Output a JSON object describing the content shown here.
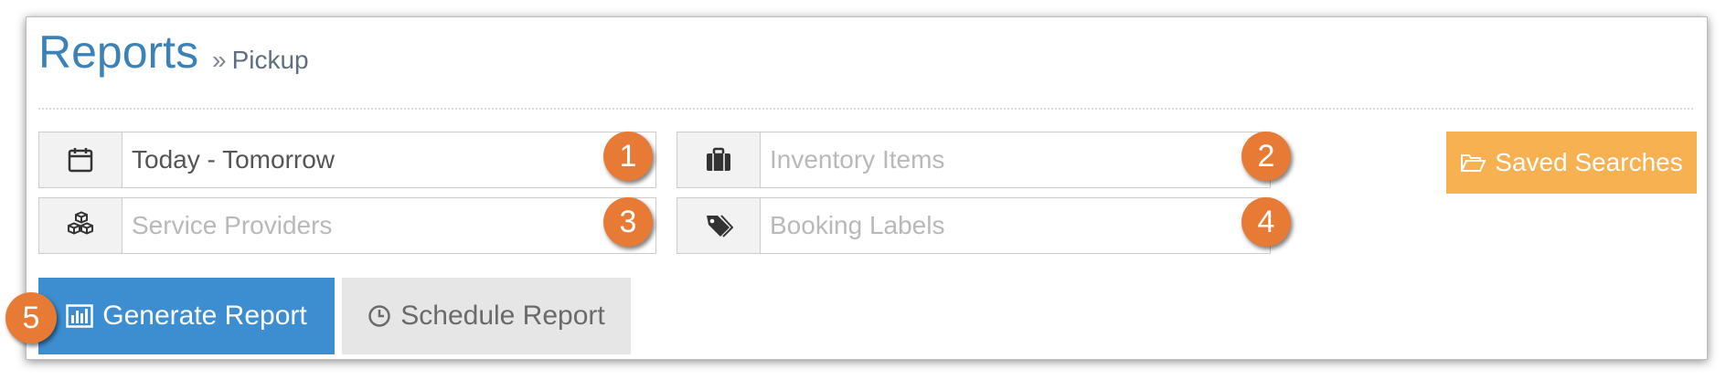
{
  "header": {
    "title": "Reports",
    "breadcrumb_separator": "»",
    "breadcrumb": "Pickup"
  },
  "filters": {
    "date_range": {
      "value": "Today - Tomorrow",
      "icon": "calendar-icon"
    },
    "inventory_items": {
      "placeholder": "Inventory Items",
      "icon": "briefcase-icon"
    },
    "service_providers": {
      "placeholder": "Service Providers",
      "icon": "cubes-icon"
    },
    "booking_labels": {
      "placeholder": "Booking Labels",
      "icon": "tags-icon"
    }
  },
  "buttons": {
    "saved_searches": {
      "label": "Saved Searches",
      "icon": "folder-open-icon"
    },
    "generate_report": {
      "label": "Generate Report",
      "icon": "bar-chart-icon"
    },
    "schedule_report": {
      "label": "Schedule Report",
      "icon": "clock-icon"
    }
  },
  "badges": [
    "1",
    "2",
    "3",
    "4",
    "5"
  ],
  "colors": {
    "title": "#3b82b8",
    "badge": "#e77b36",
    "saved_searches_bg": "#f8b151",
    "generate_bg": "#3d8ed1",
    "schedule_bg": "#e6e6e6"
  }
}
